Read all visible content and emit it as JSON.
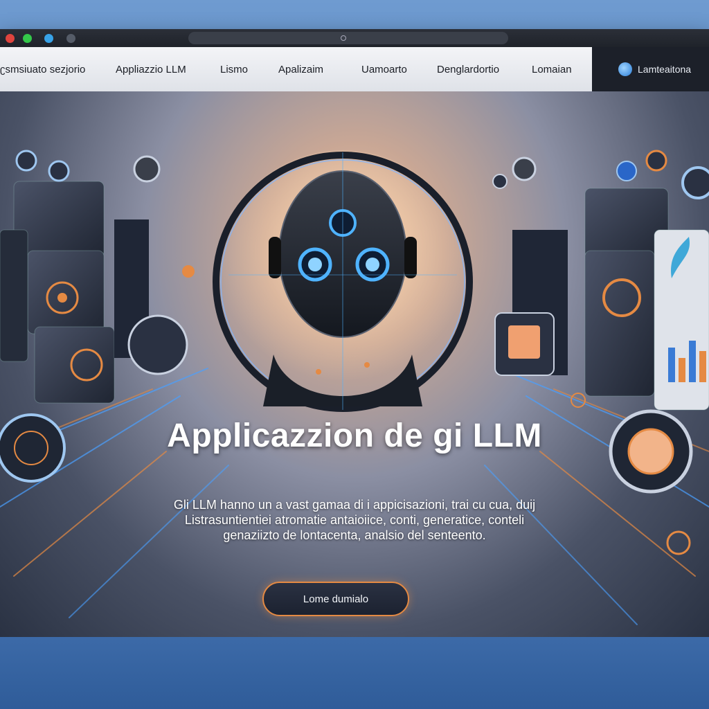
{
  "browser": {
    "controls": [
      "close-dot",
      "maximize-dot",
      "info-dot",
      "menu-dot"
    ]
  },
  "nav": {
    "links": [
      "ʗsmsiuato sezjorio",
      "Appliazzio LLM",
      "Lismo",
      "Apalizaim",
      "Uamoarto",
      "Denglardortio",
      "Lomaian"
    ],
    "user_label": "Lamteaitona"
  },
  "hero": {
    "title": "Applicazzion de gi LLM",
    "description": [
      "Gli LLM hanno un a vast gamaa di i appicisazioni, trai cu cua, duij",
      "Listrasuntientiei atromatie antaioiice, conti, generatice, conteli",
      "genaziizto de lontacenta, analsio del senteento."
    ],
    "cta_label": "Lome dumialo"
  },
  "colors": {
    "accent_orange": "#e58a43",
    "accent_blue": "#38a3e8",
    "dark_panel": "#1c2029"
  }
}
